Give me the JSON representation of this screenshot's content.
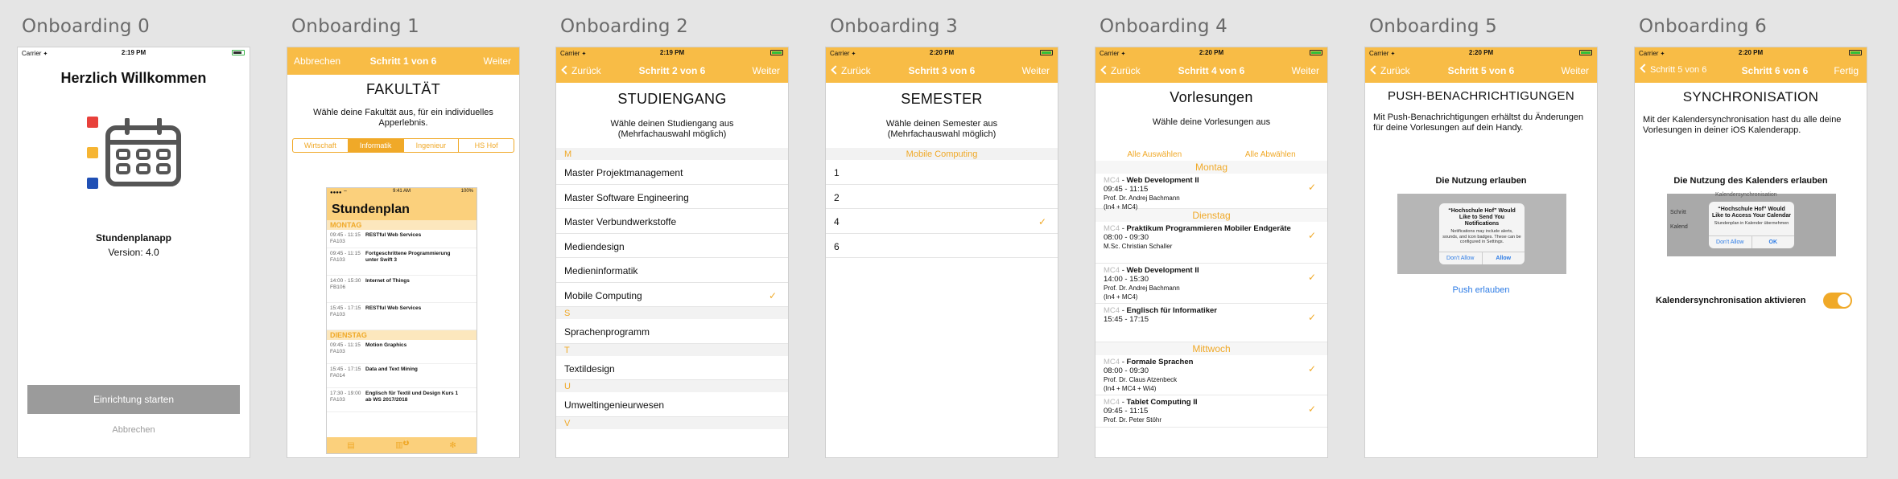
{
  "status": {
    "carrier": "Carrier",
    "wifi": "✦"
  },
  "screens": [
    {
      "title": "Onboarding 0",
      "time": "2:19 PM",
      "heading": "Herzlich Willkommen",
      "app_name": "Stundenplanapp",
      "version": "Version: 4.0",
      "start_button": "Einrichtung starten",
      "cancel_link": "Abbrechen"
    },
    {
      "title": "Onboarding 1",
      "nav_left": "Abbrechen",
      "nav_center": "Schritt 1 von 6",
      "nav_right": "Weiter",
      "heading": "FAKULTÄT",
      "subtitle": "Wähle deine Fakultät aus, für ein individuelles Apperlebnis.",
      "segments": [
        "Wirtschaft",
        "Informatik",
        "Ingenieur",
        "HS Hof"
      ],
      "preview": {
        "status_time": "9:41 AM",
        "status_batt": "100%",
        "title": "Stundenplan",
        "days": [
          {
            "name": "MONTAG",
            "rows": [
              {
                "time": "09:45 - 11:15",
                "room": "FA103",
                "name": "RESTful Web Services"
              },
              {
                "time": "09:45 - 11:15",
                "room": "FA103",
                "name": "Fortgeschrittene Programmierung unter Swift 3"
              },
              {
                "time": "14:00 - 15:30",
                "room": "FB106",
                "name": "Internet of Things"
              },
              {
                "time": "15:45 - 17:15",
                "room": "FA103",
                "name": "RESTful Web Services"
              }
            ]
          },
          {
            "name": "DIENSTAG",
            "rows": [
              {
                "time": "09:45 - 11:15",
                "room": "FA103",
                "name": "Motion Graphics"
              },
              {
                "time": "15:45 - 17:15",
                "room": "FA014",
                "name": "Data and Text Mining"
              },
              {
                "time": "17:30 - 19:00",
                "room": "FA103",
                "name": "Englisch für Textil und Design Kurs 1 ab WS 2017/2018"
              }
            ]
          }
        ],
        "badge": "1"
      }
    },
    {
      "title": "Onboarding 2",
      "time": "2:19 PM",
      "nav_left": "Zurück",
      "nav_center": "Schritt 2 von 6",
      "nav_right": "Weiter",
      "heading": "STUDIENGANG",
      "subtitle_1": "Wähle deinen Studiengang aus",
      "subtitle_2": "(Mehrfachauswahl möglich)",
      "sections": [
        {
          "letter": "M",
          "items": [
            {
              "label": "Master Projektmanagement",
              "checked": false
            },
            {
              "label": "Master Software Engineering",
              "checked": false
            },
            {
              "label": "Master Verbundwerkstoffe",
              "checked": false
            },
            {
              "label": "Mediendesign",
              "checked": false
            },
            {
              "label": "Medieninformatik",
              "checked": false
            },
            {
              "label": "Mobile Computing",
              "checked": true
            }
          ]
        },
        {
          "letter": "S",
          "items": [
            {
              "label": "Sprachenprogramm",
              "checked": false
            }
          ]
        },
        {
          "letter": "T",
          "items": [
            {
              "label": "Textildesign",
              "checked": false
            }
          ]
        },
        {
          "letter": "U",
          "items": [
            {
              "label": "Umweltingenieurwesen",
              "checked": false
            }
          ]
        },
        {
          "letter": "V",
          "items": []
        }
      ]
    },
    {
      "title": "Onboarding 3",
      "time": "2:20 PM",
      "nav_left": "Zurück",
      "nav_center": "Schritt 3 von 6",
      "nav_right": "Weiter",
      "heading": "SEMESTER",
      "subtitle_1": "Wähle deinen Semester aus",
      "subtitle_2": "(Mehrfachauswahl möglich)",
      "section": "Mobile Computing",
      "items": [
        {
          "label": "1",
          "checked": false
        },
        {
          "label": "2",
          "checked": false
        },
        {
          "label": "4",
          "checked": true
        },
        {
          "label": "6",
          "checked": false
        }
      ]
    },
    {
      "title": "Onboarding 4",
      "time": "2:20 PM",
      "nav_left": "Zurück",
      "nav_center": "Schritt 4 von 6",
      "nav_right": "Weiter",
      "heading": "Vorlesungen",
      "subtitle": "Wähle deine Vorlesungen aus",
      "select_all": "Alle Auswählen",
      "deselect_all": "Alle Abwählen",
      "days": [
        {
          "name": "Montag",
          "lectures": [
            {
              "code": "MC4",
              "name": "Web Development II",
              "time": "09:45 - 11:15",
              "prof": "Prof. Dr. Andrej Bachmann",
              "groups": "(In4 + MC4)"
            }
          ]
        },
        {
          "name": "Dienstag",
          "lectures": [
            {
              "code": "MC4",
              "name": "Praktikum Programmieren Mobiler Endgeräte",
              "time": "08:00 - 09:30",
              "prof": "M.Sc. Christian Schaller",
              "groups": ""
            },
            {
              "code": "MC4",
              "name": "Web Development II",
              "time": "14:00 - 15:30",
              "prof": "Prof. Dr. Andrej Bachmann",
              "groups": "(In4 + MC4)"
            },
            {
              "code": "MC4",
              "name": "Englisch für Informatiker",
              "time": "15:45 - 17:15",
              "prof": "",
              "groups": ""
            }
          ]
        },
        {
          "name": "Mittwoch",
          "lectures": [
            {
              "code": "MC4",
              "name": "Formale Sprachen",
              "time": "08:00 - 09:30",
              "prof": "Prof. Dr. Claus Atzenbeck",
              "groups": "(In4 + MC4 + Wi4)"
            },
            {
              "code": "MC4",
              "name": "Tablet Computing II",
              "time": "09:45 - 11:15",
              "prof": "Prof. Dr. Peter Stöhr",
              "groups": ""
            }
          ]
        }
      ]
    },
    {
      "title": "Onboarding 5",
      "time": "2:20 PM",
      "nav_left": "Zurück",
      "nav_center": "Schritt 5 von 6",
      "nav_right": "Weiter",
      "heading": "PUSH-BENACHRICHTIGUNGEN",
      "text": "Mit Push-Benachrichtigungen erhältst du Änderungen für deine Vorlesungen auf dein Handy.",
      "allow_heading": "Die Nutzung erlauben",
      "alert_title": "“Hochschule Hof” Would Like to Send You Notifications",
      "alert_body": "Notifications may include alerts, sounds, and icon badges. These can be configured in Settings.",
      "alert_deny": "Don't Allow",
      "alert_allow": "Allow",
      "push_link": "Push erlauben"
    },
    {
      "title": "Onboarding 6",
      "time": "2:20 PM",
      "nav_left": "Schritt 5 von 6",
      "nav_center": "Schritt 6 von 6",
      "nav_right": "Fertig",
      "heading": "SYNCHRONISATION",
      "text": "Mit der Kalendersynchronisation hast du alle deine Vorlesungen in deiner iOS Kalenderapp.",
      "allow_heading": "Die Nutzung des Kalenders erlauben",
      "bg_text_1": "Kalendersynchronisation",
      "bg_text_2": "Schritt",
      "bg_text_3": "Kalend",
      "alert_title": "“Hochschule Hof” Would Like to Access Your Calendar",
      "alert_body": "Stundenplan in Kalender übernehmen",
      "alert_deny": "Don't Allow",
      "alert_allow": "OK",
      "toggle_label": "Kalendersynchronisation aktivieren",
      "toggle_on": true
    }
  ]
}
